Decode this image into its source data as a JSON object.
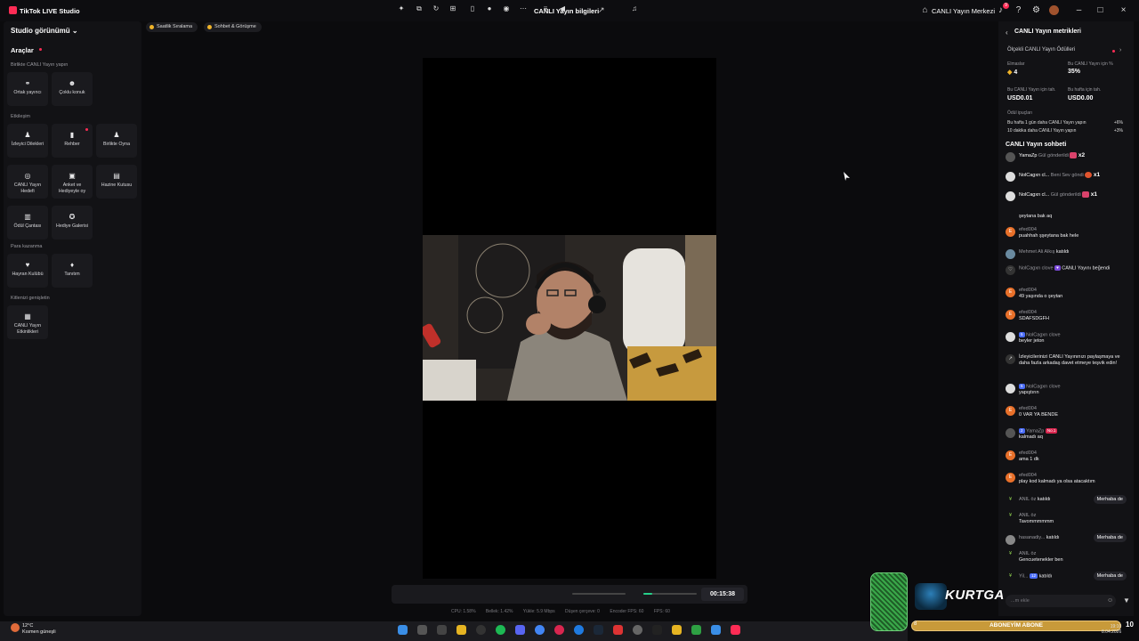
{
  "titlebar": {
    "app_title": "TikTok LIVE Studio",
    "center_title": "CANLI Yayın bilgileri",
    "live_center": "CANLI Yayın Merkezi",
    "bell_badge": "9"
  },
  "left_panel": {
    "studio_view": "Studio görünümü",
    "tools_heading": "Araçlar",
    "sections": {
      "collab": "Birlikte CANLI Yayın yapın",
      "interaction": "Etkileşim",
      "monetize": "Para kazanma",
      "audience": "Kitlenizi genişletin"
    },
    "tiles": [
      {
        "label": "Ortak yayıncı",
        "icon": "link-icon"
      },
      {
        "label": "Çoklu konuk",
        "icon": "multi-guest-icon"
      },
      {
        "label": "İzleyici Dilekleri",
        "icon": "viewer-wishes-icon"
      },
      {
        "label": "Rehber",
        "icon": "guide-icon"
      },
      {
        "label": "Birlikte Oyna",
        "icon": "play-together-icon"
      },
      {
        "label": "CANLI Yayın Hedefi",
        "icon": "target-icon"
      },
      {
        "label": "Anket ve Hediyeyle oy",
        "icon": "poll-icon"
      },
      {
        "label": "Hazine Kutusu",
        "icon": "treasure-icon"
      },
      {
        "label": "Ödül Çantası",
        "icon": "bag-icon"
      },
      {
        "label": "Hediye Galerisi",
        "icon": "gift-gallery-icon"
      },
      {
        "label": "Hayran Kulübü",
        "icon": "heart-icon"
      },
      {
        "label": "Tanıtım",
        "icon": "flame-icon"
      },
      {
        "label": "CANLI Yayın Etkinlikleri",
        "icon": "events-icon"
      }
    ]
  },
  "top_pills": {
    "ranking": "Saatlik Sıralama",
    "chat": "Sohbet & Görüşme"
  },
  "toolbar": {
    "timer": "00:15:38",
    "volume_level": 0,
    "mic_level": 0.17,
    "stats": {
      "cpu": "CPU: 1.58%",
      "memory": "Bellek: 1.42%",
      "upload": "Yükle: 5.9 Mbps",
      "dropped": "Düşen çerçeve: 0",
      "encoder": "Encoder FPS: 60",
      "fps": "FPS: 60"
    }
  },
  "right_panel": {
    "metrics_heading": "CANLI Yayın metrikleri",
    "rewards_title": "Ölçekli CANLI Yayın Ödülleri",
    "metrics": [
      {
        "label": "Elmaslar",
        "value": "4"
      },
      {
        "label": "Bu CANLI Yayın için %",
        "value": "35%"
      },
      {
        "label": "Bu CANLI Yayın için tah.",
        "value": "USD0.01"
      },
      {
        "label": "Bu hafta için tah.",
        "value": "USD0.00"
      }
    ],
    "tips_label": "Ödül ipuçları",
    "tips": [
      {
        "text": "Bu hafta 1 gün daha CANLI Yayın yapın",
        "value": "+6%"
      },
      {
        "text": "10 dakika daha CANLI Yayın yapın",
        "value": "+3%"
      }
    ],
    "chat_heading": "CANLI Yayın sohbeti",
    "comment_placeholder": "...m ekle",
    "messages": [
      {
        "user": "YamaZp",
        "text": "Gül gönderildi",
        "mult": "x2"
      },
      {
        "user": "NolCagxn cl...",
        "text": "Beni Sev göndi",
        "mult": "x1"
      },
      {
        "user": "NolCagxn cl...",
        "text": "Gül gönderildi",
        "mult": "x1"
      },
      {
        "user": "",
        "text": "şeytana bak aq"
      },
      {
        "user": "efed004",
        "text": "puahhah şşeytana bak hele"
      },
      {
        "user": "Mehmet Ali Alkış",
        "text": "katıldı"
      },
      {
        "user": "NolCagxn clove",
        "text": "CANLI Yayını beğendi"
      },
      {
        "user": "efed004",
        "text": "49 yaşında o şeytan"
      },
      {
        "user": "efed004",
        "text": "SDAFSDGFH"
      },
      {
        "user": "NolCagxn clove",
        "badge": "5",
        "text": "beyler jeton"
      },
      {
        "user": "",
        "text": "İzleyicilerinizi CANLI Yayınınızı paylaşmaya ve daha fazla arkadaş davet etmeye teşvik edin!"
      },
      {
        "user": "NolCagxn clove",
        "badge": "5",
        "text": "yapıştırın"
      },
      {
        "user": "efed004",
        "text": "0 VAR YA BENDE"
      },
      {
        "user": "YamaZp",
        "badge": "2",
        "rank": "No.1",
        "text": "kalmadı aq"
      },
      {
        "user": "efed004",
        "text": "ama 1 dk"
      },
      {
        "user": "efed004",
        "text": "play kod kalmadı ya olsa atacaktım"
      },
      {
        "user": "ANIL öz",
        "text": "katıldı",
        "button": "Merhaba de"
      },
      {
        "user": "ANIL öz",
        "text": "Tavommmmmm"
      },
      {
        "user": "hasanadiy...",
        "text": "katıldı",
        "button": "Merhaba de"
      },
      {
        "user": "ANIL öz",
        "text": "Gencuetenekler ben"
      },
      {
        "user": "Yil...",
        "badge": "12",
        "text": "katıldı",
        "button": "Merhaba de"
      }
    ]
  },
  "overlay": {
    "brand": "KURTGA",
    "sub_text": "ABONEYİM ABONE",
    "sub_left": "8",
    "sub_right": "10"
  },
  "taskbar": {
    "temp": "12°C",
    "weather": "Kısmen güneşli",
    "time": "19:10",
    "date": "8.04.2026"
  }
}
